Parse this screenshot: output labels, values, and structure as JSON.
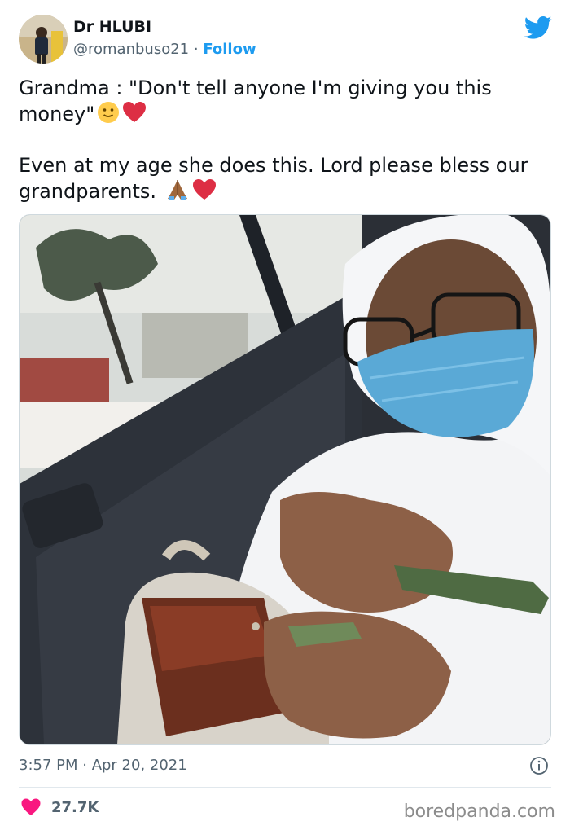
{
  "author": {
    "name": "Dr HLUBI",
    "handle": "@romanbuso21",
    "separator": "·",
    "follow_label": "Follow"
  },
  "tweet": {
    "line1": "Grandma : \"Don't tell anyone I'm giving you this money\"",
    "line2": "Even at my age she does this. Lord please bless our grandparents.",
    "emojis_line1": [
      "slightly-smiling-face",
      "red-heart"
    ],
    "emojis_line2": [
      "folded-hands",
      "red-heart"
    ]
  },
  "photo": {
    "description_icon": "photo-elderly-woman-in-car-giving-money"
  },
  "meta": {
    "timestamp": "3:57 PM · Apr 20, 2021",
    "like_count": "27.7K"
  },
  "watermark": "boredpanda.com",
  "colors": {
    "twitter_blue": "#1d9bf0",
    "like_pink": "#f91880",
    "text_primary": "#0f1419",
    "text_secondary": "#536471"
  }
}
